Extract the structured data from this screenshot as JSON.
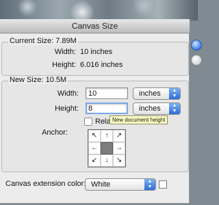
{
  "window": {
    "title": "Canvas Size"
  },
  "current_size": {
    "label": "Current Size: 7.89M",
    "width_label": "Width:",
    "width_value": "10 inches",
    "height_label": "Height:",
    "height_value": "6.016 inches"
  },
  "new_size": {
    "label": "New Size: 10.5M",
    "width_label": "Width:",
    "width_value": "10",
    "width_unit": "inches",
    "height_label": "Height:",
    "height_value": "8",
    "height_unit": "inches",
    "relative_label": "Relative",
    "relative_checked": false,
    "tooltip": "New document height",
    "anchor_label": "Anchor:",
    "anchor_cells": [
      "↖",
      "↑",
      "↗",
      "←",
      "",
      "→",
      "↙",
      "↓",
      "↘"
    ]
  },
  "extension": {
    "label": "Canvas extension color:",
    "value": "White",
    "swatch_color": "#ffffff"
  },
  "colors": {
    "accent": "#3b7de0",
    "dialog_bg": "#ececec"
  }
}
